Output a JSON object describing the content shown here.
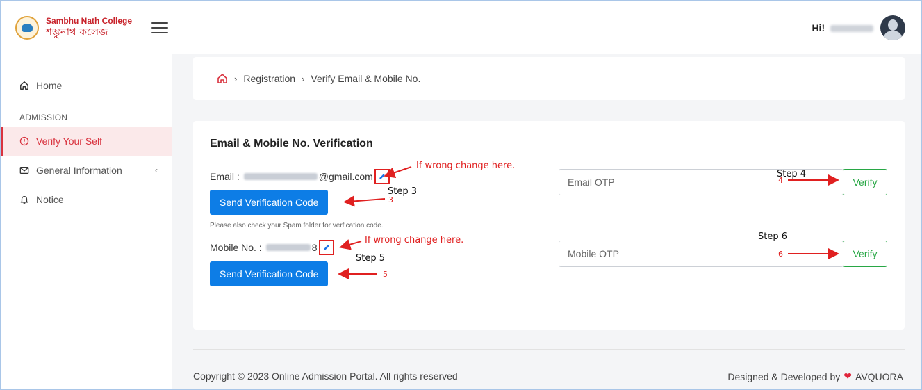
{
  "sidebar": {
    "logo": {
      "name_en": "Sambhu Nath College",
      "name_bn": "শম্ভুনাথ কলেজ"
    },
    "home_label": "Home",
    "section_label": "ADMISSION",
    "items": [
      {
        "label": "Verify Your Self",
        "icon": "alert-circle-icon",
        "active": true
      },
      {
        "label": "General Information",
        "icon": "envelope-icon",
        "active": false
      },
      {
        "label": "Notice",
        "icon": "bell-icon",
        "active": false
      }
    ]
  },
  "topbar": {
    "greeting": "Hi!"
  },
  "breadcrumb": {
    "items": [
      "Registration",
      "Verify Email & Mobile No."
    ]
  },
  "card": {
    "title": "Email & Mobile No. Verification",
    "email_label": "Email :",
    "email_suffix": "@gmail.com",
    "send_email_btn": "Send Verification Code",
    "spam_hint": "Please also check your Spam folder for verfication code.",
    "mobile_label": "Mobile No. :",
    "mobile_suffix": "8",
    "send_mobile_btn": "Send Verification Code",
    "email_otp_placeholder": "Email OTP",
    "mobile_otp_placeholder": "Mobile OTP",
    "verify_label": "Verify"
  },
  "annotations": {
    "wrong_change": "If wrong change here.",
    "step3": "Step 3",
    "n3": "3",
    "step4": "Step 4",
    "n4": "4",
    "step5": "Step 5",
    "n5": "5",
    "step6": "Step 6",
    "n6": "6"
  },
  "footer": {
    "copyright": "Copyright © 2023 Online Admission Portal. All rights reserved",
    "designed_by": "Designed & Developed by",
    "company": "AVQUORA"
  },
  "colors": {
    "accent": "#d9333f",
    "primary_button": "#0d7de6",
    "verify": "#28a745",
    "annotation": "#e02020"
  }
}
